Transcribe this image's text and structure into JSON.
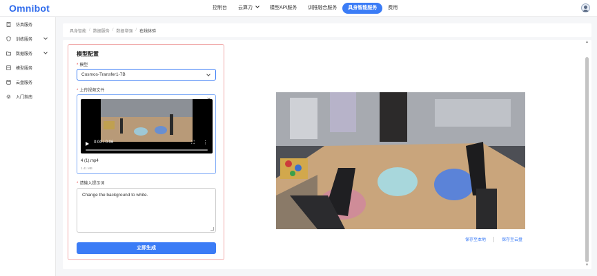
{
  "brand": {
    "logo": "Omnibot"
  },
  "topnav": {
    "items": [
      {
        "label": "控制台",
        "active": false,
        "dropdown": false
      },
      {
        "label": "云算力",
        "active": false,
        "dropdown": true
      },
      {
        "label": "模型API服务",
        "active": false,
        "dropdown": false
      },
      {
        "label": "训推融合服务",
        "active": false,
        "dropdown": false
      },
      {
        "label": "具身智能服务",
        "active": true,
        "dropdown": false
      },
      {
        "label": "费用",
        "active": false,
        "dropdown": false
      }
    ]
  },
  "sidebar": {
    "items": [
      {
        "label": "仿真服务",
        "icon": "document-icon",
        "expandable": false
      },
      {
        "label": "训练服务",
        "icon": "shield-icon",
        "expandable": true
      },
      {
        "label": "数据服务",
        "icon": "folder-icon",
        "expandable": true
      },
      {
        "label": "模型服务",
        "icon": "layers-icon",
        "expandable": false
      },
      {
        "label": "云盘服务",
        "icon": "disk-icon",
        "expandable": false
      },
      {
        "label": "入门指南",
        "icon": "gear-icon",
        "expandable": false
      }
    ]
  },
  "breadcrumb": [
    "具身智能",
    "数据服务",
    "数据增强",
    "在线体验"
  ],
  "config": {
    "title": "模型配置",
    "model_label": "模型",
    "model_value": "Cosmos-Transfer1-7B",
    "upload_label": "上传视频文件",
    "video": {
      "time": "0:00 / 0:06",
      "filename": "4 (1).mp4",
      "filesize": "1.41 MB"
    },
    "prompt_label": "请输入提示词",
    "prompt_value": "Change the background to white.",
    "generate_label": "立即生成"
  },
  "result_actions": {
    "save_local": "保存至本地",
    "save_cloud": "保存至云盘"
  },
  "colors": {
    "accent": "#3b7cf6",
    "required": "#e54545",
    "panel_border": "#f0a8a8"
  }
}
